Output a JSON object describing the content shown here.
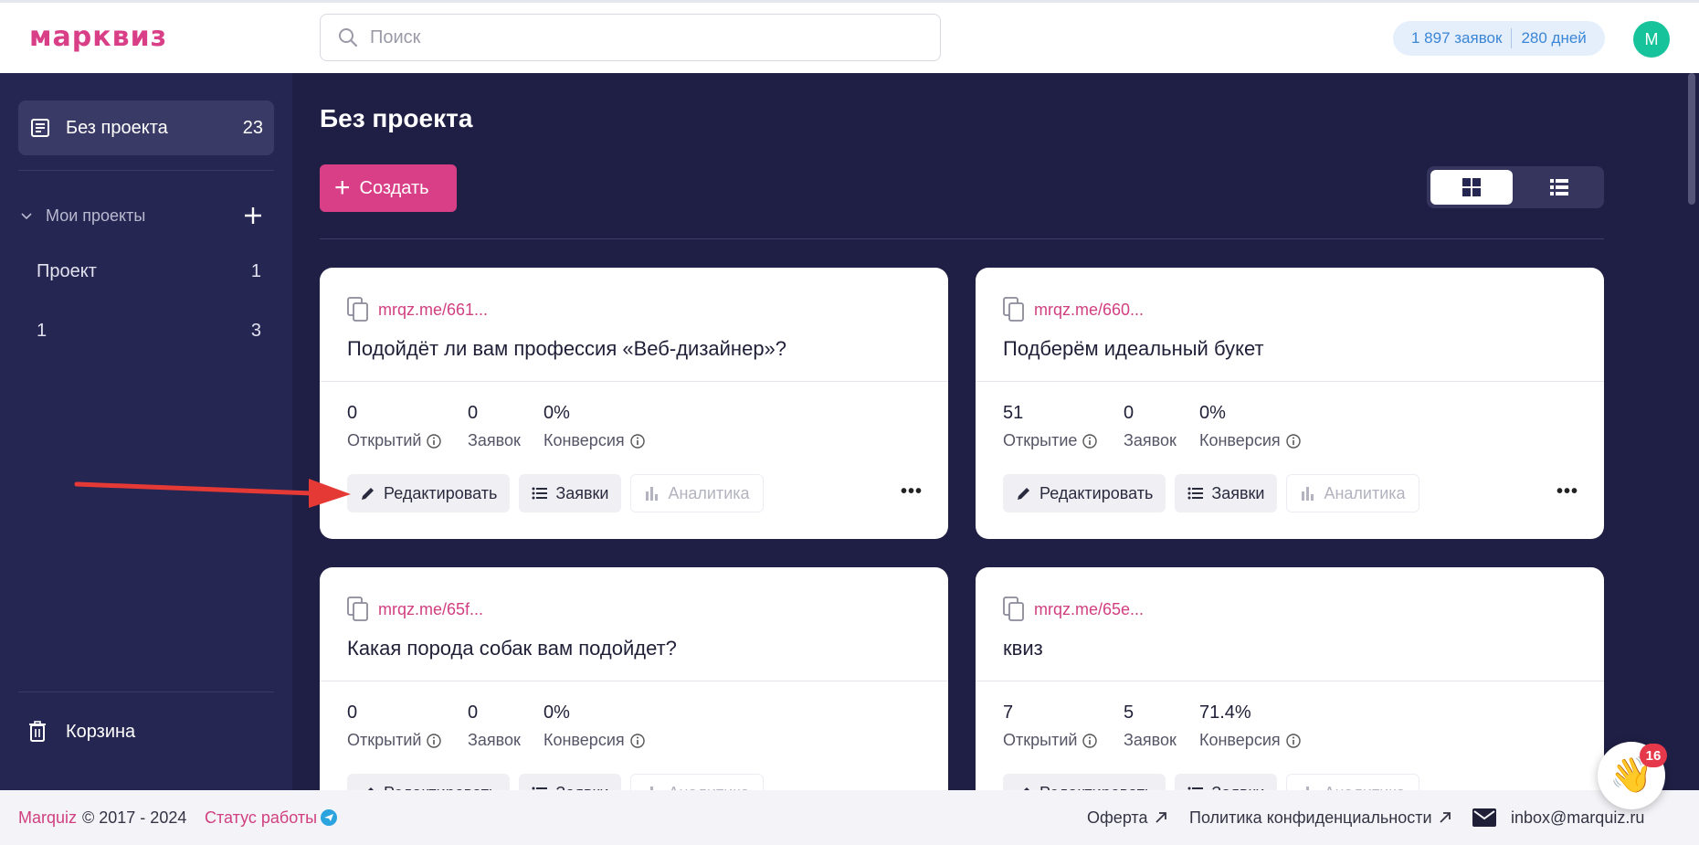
{
  "header": {
    "logo": "марквиз",
    "search_placeholder": "Поиск",
    "leads_count": "1 897 заявок",
    "days_left": "280 дней",
    "avatar_letter": "М"
  },
  "sidebar": {
    "active": {
      "label": "Без проекта",
      "count": "23"
    },
    "group_label": "Мои проекты",
    "items": [
      {
        "label": "Проект",
        "count": "1"
      },
      {
        "label": "1",
        "count": "3"
      }
    ],
    "trash_label": "Корзина"
  },
  "main": {
    "title": "Без проекта",
    "create_label": "Создать",
    "cards": [
      {
        "link": "mrqz.me/661...",
        "title": "Подойдёт ли вам профессия «Веб-дизайнер»?",
        "metrics": [
          {
            "value": "0",
            "label": "Открытий"
          },
          {
            "value": "0",
            "label": "Заявок"
          },
          {
            "value": "0%",
            "label": "Конверсия"
          }
        ]
      },
      {
        "link": "mrqz.me/660...",
        "title": "Подберём идеальный букет",
        "metrics": [
          {
            "value": "51",
            "label": "Открытие"
          },
          {
            "value": "0",
            "label": "Заявок"
          },
          {
            "value": "0%",
            "label": "Конверсия"
          }
        ]
      },
      {
        "link": "mrqz.me/65f...",
        "title": "Какая порода собак вам подойдет?",
        "metrics": [
          {
            "value": "0",
            "label": "Открытий"
          },
          {
            "value": "0",
            "label": "Заявок"
          },
          {
            "value": "0%",
            "label": "Конверсия"
          }
        ]
      },
      {
        "link": "mrqz.me/65e...",
        "title": "квиз",
        "metrics": [
          {
            "value": "7",
            "label": "Открытий"
          },
          {
            "value": "5",
            "label": "Заявок"
          },
          {
            "value": "71.4%",
            "label": "Конверсия"
          }
        ]
      }
    ],
    "actions": {
      "edit": "Редактировать",
      "leads": "Заявки",
      "analytics": "Аналитика",
      "more": "•••"
    }
  },
  "footer": {
    "brand": "Marquiz",
    "copyright": "© 2017 - 2024",
    "status": "Статус работы",
    "oferta": "Оферта",
    "policy": "Политика конфиденциальности",
    "email": "inbox@marquiz.ru"
  },
  "chat_badge": "16",
  "colors": {
    "accent": "#d93f87",
    "sidebar": "#262652",
    "background": "#1f1f45",
    "link": "#d03f80"
  }
}
